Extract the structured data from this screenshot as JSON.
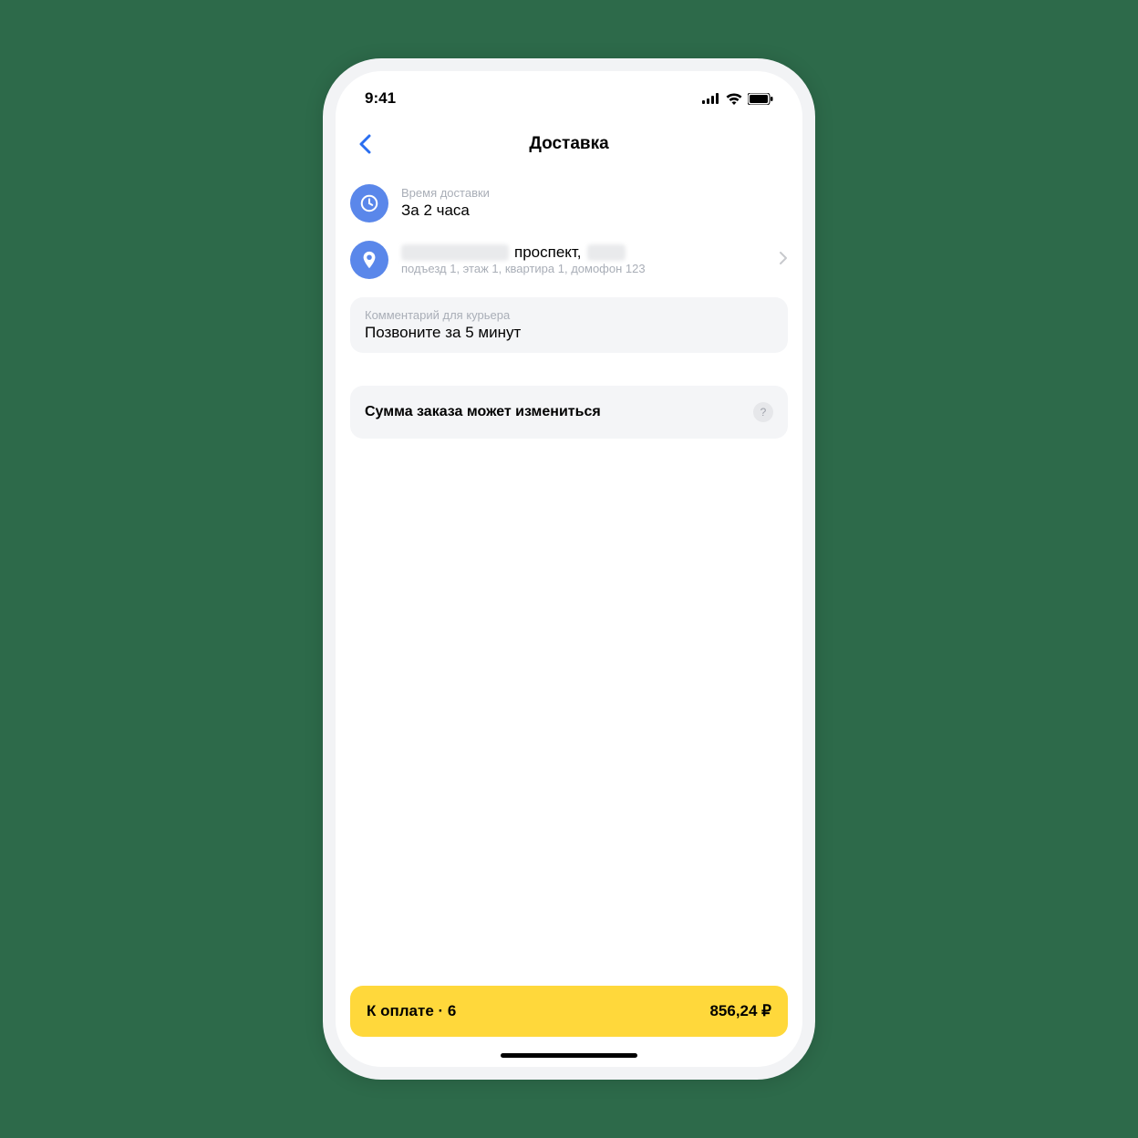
{
  "status": {
    "time": "9:41"
  },
  "nav": {
    "title": "Доставка"
  },
  "delivery_time": {
    "caption": "Время доставки",
    "value": "За 2 часа"
  },
  "address": {
    "line1_visible": "проспект,",
    "line2": "подъезд 1, этаж 1, квартира 1, домофон 123"
  },
  "comment": {
    "caption": "Комментарий для курьера",
    "value": "Позвоните за 5 минут"
  },
  "notice": {
    "text": "Сумма заказа может измениться",
    "q": "?"
  },
  "pay": {
    "label": "К оплате · 6",
    "amount": "856,24 ₽"
  }
}
